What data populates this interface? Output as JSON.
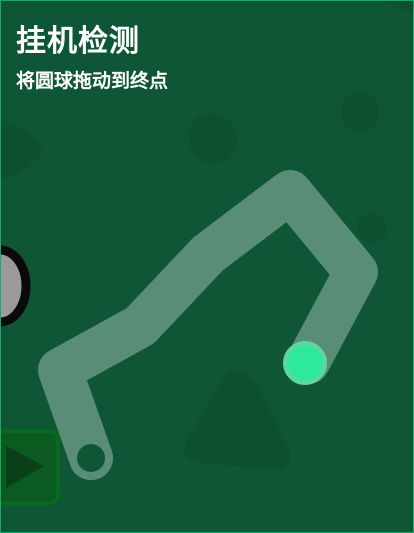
{
  "header": {
    "title": "挂机检测",
    "instruction": "将圆球拖动到终点"
  },
  "colors": {
    "background": "#0e5636",
    "frame_border": "#1ea764",
    "decor_shape": "#0c4f31",
    "track": "#5a8d78",
    "start_ring": "#5a8d78",
    "start_hole": "#0e5636",
    "ball": "#2ee89e",
    "ball_border": "#5fd59f",
    "play_button_bg": "#0a5a22",
    "play_button_border": "#086a1c",
    "play_icon": "#0a4018",
    "left_widget_ring": "#0a0a0a",
    "left_widget_fill": "#9a9a9a"
  },
  "icons": {
    "play_button": "play-icon",
    "left_widget": "partial-circle-icon"
  }
}
